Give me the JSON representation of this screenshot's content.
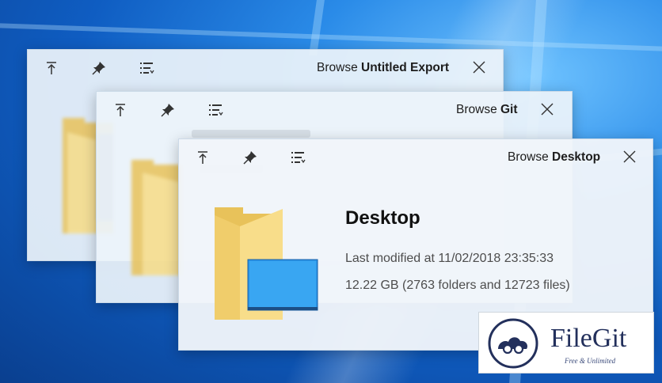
{
  "windows": [
    {
      "title_prefix": "Browse",
      "title_name": "Untitled Export",
      "toolbar": {
        "pin_top_icon": "pin-to-top-icon",
        "pin_icon": "pushpin-icon",
        "options_icon": "list-options-icon",
        "close_icon": "close-icon"
      }
    },
    {
      "title_prefix": "Browse",
      "title_name": "Git",
      "toolbar": {
        "pin_top_icon": "pin-to-top-icon",
        "pin_icon": "pushpin-icon",
        "options_icon": "list-options-icon",
        "close_icon": "close-icon"
      }
    },
    {
      "title_prefix": "Browse",
      "title_name": "Desktop",
      "folder_name": "Desktop",
      "last_modified": "Last modified at 11/02/2018 23:35:33",
      "size_summary": "12.22 GB (2763 folders and 12723 files)",
      "toolbar": {
        "pin_top_icon": "pin-to-top-icon",
        "pin_icon": "pushpin-icon",
        "options_icon": "list-options-icon",
        "close_icon": "close-icon"
      }
    }
  ],
  "watermark": {
    "brand": "FileGit",
    "tagline": "Free & Unlimited"
  },
  "colors": {
    "desktop_blue": "#0f5dc2",
    "window_bg": "#ecf3fa",
    "folder_yellow": "#f6d57a",
    "desktop_badge_blue": "#2b95e8",
    "brand_navy": "#23305c"
  }
}
